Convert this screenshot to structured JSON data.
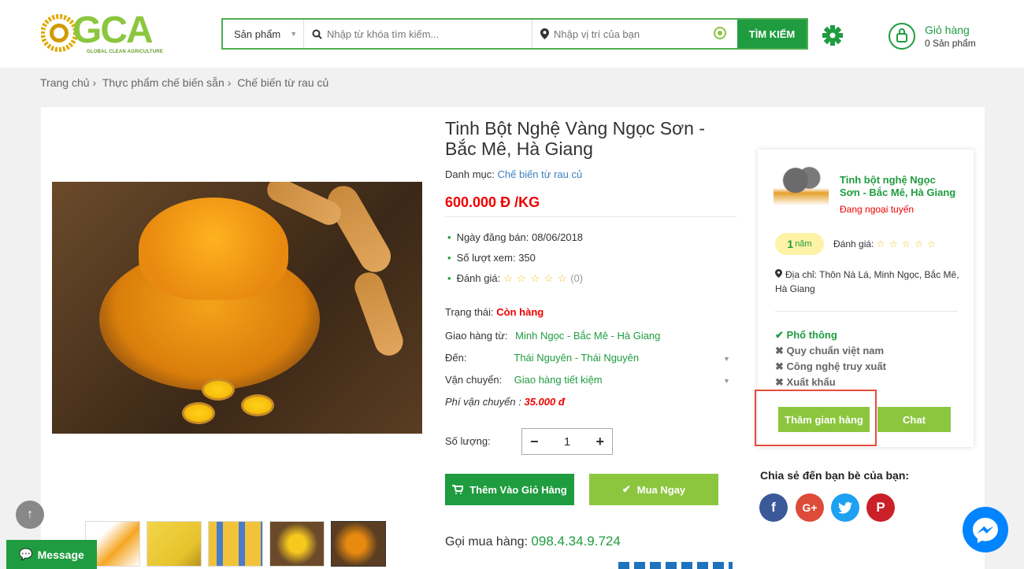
{
  "header": {
    "logo_text": "GCA",
    "logo_sub": "GLOBAL CLEAN AGRICULTURE",
    "category_label": "Sản phẩm",
    "keyword_placeholder": "Nhập từ khóa tìm kiếm...",
    "location_placeholder": "Nhập vị trí của bạn",
    "search_label": "TÌM KIẾM",
    "cart_title": "Giỏ hàng",
    "cart_count": "0 Sản phẩm"
  },
  "breadcrumb": [
    "Trang chủ",
    "Thực phẩm chế biến sẵn",
    "Chế biến từ rau củ"
  ],
  "product": {
    "title": "Tinh Bột Nghệ Vàng Ngọc Sơn - Bắc Mê, Hà Giang",
    "category_label": "Danh mục:",
    "category": "Chế biến từ rau củ",
    "price": "600.000 Đ /KG",
    "post_date": "Ngày đăng bán: 08/06/2018",
    "views": "Số lượt xem: 350",
    "rating_label": "Đánh giá:",
    "rating_stars": "☆ ☆ ☆ ☆ ☆",
    "rating_count": "(0)",
    "status_label": "Trạng thái:",
    "status": "Còn hàng",
    "ship_from_label": "Giao hàng từ:",
    "ship_from": "Minh Ngọc - Bắc Mê - Hà Giang",
    "ship_to_label": "Đến:",
    "ship_to": "Thái Nguyên - Thái Nguyên",
    "shipping_label": "Vận chuyển:",
    "shipping": "Giao hàng tiết kiệm",
    "fee_label": "Phí vận chuyển :",
    "fee": "35.000 đ",
    "qty_label": "Số lượng:",
    "qty": "1",
    "add_cart": "Thêm Vào Giỏ Hàng",
    "buy_now": "Mua Ngay",
    "call_label": "Gọi mua hàng:",
    "phone": "098.4.34.9.724"
  },
  "shop": {
    "name": "Tinh bột nghệ Ngọc Sơn - Bắc Mê, Hà Giang",
    "status": "Đang ngoại tuyến",
    "years_num": "1",
    "years_unit": "năm",
    "rating_label": "Đánh giá:",
    "rating_stars": "☆ ☆ ☆ ☆ ☆",
    "address": "Địa chỉ: Thôn Nà Lá, Minh Ngọc, Bắc Mê, Hà Giang",
    "tags": [
      "Phổ thông",
      "Quy chuẩn việt nam",
      "Công nghệ truy xuất",
      "Xuất khẩu"
    ],
    "visit": "Thăm gian hàng",
    "chat": "Chat"
  },
  "share_title": "Chia sẻ đến bạn bè của bạn:",
  "message_label": "Message",
  "colors": {
    "primary_green": "#1f9c3f",
    "light_green": "#8cc63f",
    "price_red": "#e00000"
  }
}
